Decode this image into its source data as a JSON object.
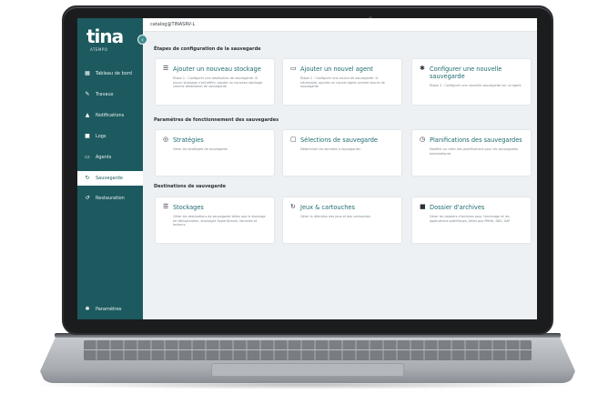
{
  "app": {
    "logo": "tina",
    "logo_sub": "ATEMPO",
    "topbar_title": "catalog@TINASRV-L"
  },
  "sidebar": {
    "collapse_icon": "chevron-left-icon",
    "items": [
      {
        "label": "Tableau de bord",
        "icon": "dashboard-icon"
      },
      {
        "label": "Travaux",
        "icon": "wrench-icon"
      },
      {
        "label": "Notifications",
        "icon": "bell-icon"
      },
      {
        "label": "Logs",
        "icon": "log-icon"
      },
      {
        "label": "Agents",
        "icon": "monitor-icon"
      },
      {
        "label": "Sauvegarde",
        "icon": "backup-icon"
      },
      {
        "label": "Restauration",
        "icon": "restore-icon"
      },
      {
        "label": "Paramètres",
        "icon": "gear-icon"
      }
    ],
    "active": "Sauvegarde"
  },
  "sections": [
    {
      "title": "Étapes de configuration de la sauvegarde",
      "cards": [
        {
          "title": "Ajouter un nouveau stockage",
          "desc": "Étape 1 : Configurer une destination de sauvegarde. Si aucun stockage n'est défini, ajouter un nouveau stockage comme destination de sauvegarde",
          "icon": "storage-icon"
        },
        {
          "title": "Ajouter un nouvel agent",
          "desc": "Étape 2 : Configurer une source de sauvegarde. Si nécessaire, ajoutez un nouvel agent comme source de sauvegarde",
          "icon": "monitor-icon"
        },
        {
          "title": "Configurer une nouvelle sauvegarde",
          "desc": "Étape 3 : Configurer une nouvelle sauvegarde sur un agent",
          "icon": "gear-icon"
        }
      ]
    },
    {
      "title": "Paramètres de fonctionnement des sauvegardes",
      "cards": [
        {
          "title": "Stratégies",
          "desc": "Gérer les stratégies de sauvegarde",
          "icon": "strategy-icon"
        },
        {
          "title": "Sélections de sauvegarde",
          "desc": "Déterminer les données à sauvegarder",
          "icon": "folder-icon"
        },
        {
          "title": "Planifications des sauvegardes",
          "desc": "Modifier ou créer des planifications pour les sauvegardes automatiques",
          "icon": "clock-icon"
        }
      ]
    },
    {
      "title": "Destinations de sauvegarde",
      "cards": [
        {
          "title": "Stockages",
          "desc": "Gérer les destinations de sauvegarde telles que le stockage de déduplication, stockages HyperStream, librairies et lecteurs",
          "icon": "storage-icon"
        },
        {
          "title": "Jeux & cartouches",
          "desc": "Gérer la rétention des jeux et des cartouches",
          "icon": "cycle-icon"
        },
        {
          "title": "Dossier d'archives",
          "desc": "Gérer les dossiers d'archives pour l'archivage et les applications spécifiques, telles que PMHA, DB2, SAP",
          "icon": "archive-icon"
        }
      ]
    }
  ]
}
